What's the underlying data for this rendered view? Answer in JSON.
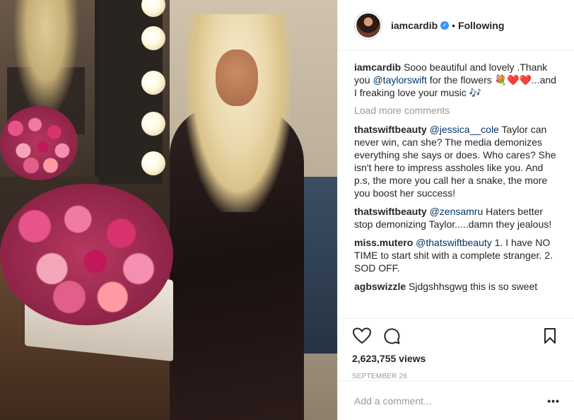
{
  "post": {
    "username": "iamcardib",
    "follow_state": "Following",
    "caption_user": "iamcardib",
    "caption_pre": "Sooo beautiful and lovely .Thank you ",
    "caption_mention": "@taylorswift",
    "caption_post": " for the flowers 💐❤️❤️...and I freaking love your music 🎶",
    "load_more": "Load more comments",
    "views": "2,623,755 views",
    "date": "SEPTEMBER 26",
    "add_comment_placeholder": "Add a comment...",
    "more_label": "•••"
  },
  "comments": [
    {
      "user": "thatswiftbeauty",
      "mention": "@jessica__cole",
      "text": " Taylor can never win, can she? The media demonizes everything she says or does. Who cares? She isn't here to impress assholes like you. And p.s, the more you call her a snake, the more you boost her success!"
    },
    {
      "user": "thatswiftbeauty",
      "mention": "@zensamru",
      "text": " Haters better stop demonizing Taylor.....damn they jealous!"
    },
    {
      "user": "miss.mutero",
      "mention": "@thatswiftbeauty",
      "text": " 1. I have NO TIME to start shit with a complete stranger. 2. SOD OFF."
    },
    {
      "user": "agbswizzle",
      "mention": "",
      "text": " Sjdgshhsgwg this is so sweet"
    }
  ],
  "icons": {
    "like": "heart-icon",
    "comment": "comment-icon",
    "save": "bookmark-icon",
    "verified": "verified-badge-icon"
  },
  "colors": {
    "mention": "#003569",
    "verified": "#3897f0",
    "muted": "#999999"
  }
}
